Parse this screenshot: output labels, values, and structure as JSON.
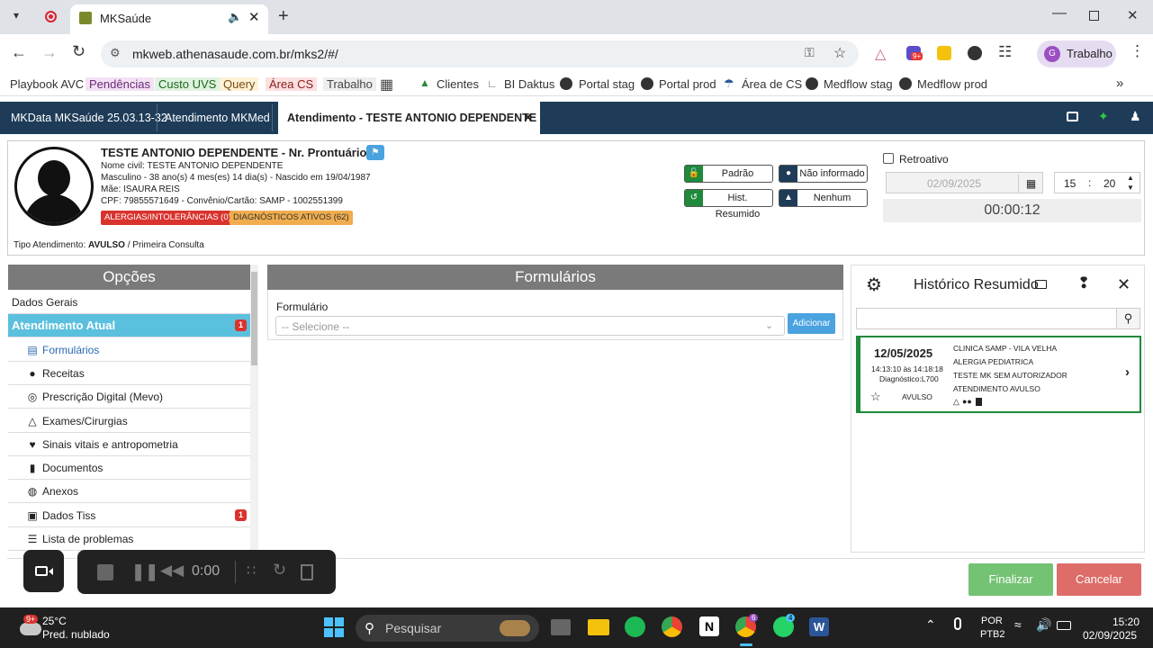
{
  "browser": {
    "tab_title": "MKSaúde",
    "url": "mkweb.athenasaude.com.br/mks2/#/",
    "profile_label": "Trabalho",
    "profile_initial": "G",
    "ext_badge": "9+"
  },
  "bookmarks": [
    "Playbook AVC",
    "Pendências",
    "Custo UVS",
    "Query",
    "Área CS",
    "Trabalho",
    "Clientes",
    "BI Daktus",
    "Portal stag",
    "Portal prod",
    "Área de CS",
    "Medflow stag",
    "Medflow prod"
  ],
  "app_tabs": [
    "MKData MKSaúde 25.03.13-32",
    "Atendimento MKMed",
    "Atendimento - TESTE ANTONIO DEPENDENTE"
  ],
  "patient": {
    "name_line": "TESTE ANTONIO DEPENDENTE - Nr. Prontuário:",
    "civil_name": "Nome civil: TESTE ANTONIO DEPENDENTE",
    "age_line": "Masculino - 38 ano(s) 4 mes(es) 14 dia(s) - Nascido em 19/04/1987",
    "mother": "Mãe: ISAURA REIS",
    "cpf_line": "CPF: 79855571649 - Convênio/Cartão: SAMP - 1002551399",
    "allergies_badge": "ALERGIAS/INTOLERÂNCIAS (0)",
    "diagnoses_badge": "DIAGNÓSTICOS ATIVOS (62)",
    "tipo_label": "Tipo Atendimento:",
    "tipo_value": "AVULSO",
    "tipo_extra": "/ Primeira Consulta"
  },
  "status_buttons": {
    "padrao": "Padrão",
    "nao_informado": "Não informado",
    "hist_resumido": "Hist. Resumido",
    "nenhum": "Nenhum"
  },
  "retro": {
    "label": "Retroativo",
    "date": "02/09/2025",
    "hour": "15",
    "minute": "20",
    "timer": "00:00:12"
  },
  "opcoes": {
    "title": "Opções",
    "items": [
      {
        "label": "Dados Gerais",
        "icon": "none",
        "badge": ""
      },
      {
        "label": "Atendimento Atual",
        "icon": "none",
        "badge": "1"
      },
      {
        "label": "Formulários",
        "icon": "document-icon",
        "badge": ""
      },
      {
        "label": "Receitas",
        "icon": "pills-icon",
        "badge": ""
      },
      {
        "label": "Prescrição Digital (Mevo)",
        "icon": "prescription-icon",
        "badge": ""
      },
      {
        "label": "Exames/Cirurgias",
        "icon": "flask-icon",
        "badge": ""
      },
      {
        "label": "Sinais vitais e antropometria",
        "icon": "heartbeat-icon",
        "badge": ""
      },
      {
        "label": "Documentos",
        "icon": "file-icon",
        "badge": ""
      },
      {
        "label": "Anexos",
        "icon": "paperclip-icon",
        "badge": ""
      },
      {
        "label": "Dados Tiss",
        "icon": "copy-icon",
        "badge": "1"
      },
      {
        "label": "Lista de problemas",
        "icon": "list-icon",
        "badge": ""
      }
    ]
  },
  "formularios": {
    "title": "Formulários",
    "field_label": "Formulário",
    "select_placeholder": "-- Selecione --",
    "add_button": "Adicionar"
  },
  "historico": {
    "title": "Histórico Resumido",
    "card": {
      "date": "12/05/2025",
      "time": "14:13:10 às 14:18:18",
      "diagnostico": "Diagnóstico:L700",
      "tipo": "AVULSO",
      "line1": "CLINICA SAMP - VILA VELHA",
      "line2": "ALERGIA PEDIATRICA",
      "line3": "TESTE MK SEM AUTORIZADOR",
      "line4": "ATENDIMENTO AVULSO"
    }
  },
  "actions": {
    "finalizar": "Finalizar",
    "cancelar": "Cancelar"
  },
  "recorder": {
    "time": "0:00"
  },
  "taskbar": {
    "temp": "25°C",
    "weather": "Pred. nublado",
    "weather_badge": "9+",
    "search": "Pesquisar",
    "lang1": "POR",
    "lang2": "PTB2",
    "time": "15:20",
    "date": "02/09/2025",
    "chrome_badge": "6",
    "whatsapp_badge": "4"
  },
  "colors": {
    "nav": "#1e3c58",
    "accent": "#4aa3df",
    "finalize": "#5cb85c",
    "cancel": "#d9534f",
    "card_border": "#1e8a3a"
  }
}
